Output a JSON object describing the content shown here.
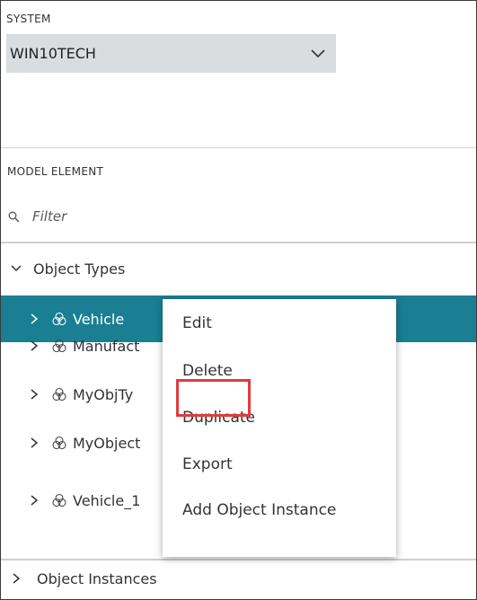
{
  "system": {
    "label": "SYSTEM",
    "selected_value": "WIN10TECH",
    "dropdown_icon": "chevron-down-icon"
  },
  "model_element": {
    "label": "MODEL ELEMENT",
    "filter_placeholder": "Filter",
    "filter_icon": "search-icon"
  },
  "tree": {
    "object_types": {
      "label": "Object Types",
      "expanded": true
    },
    "items": [
      {
        "label": "Vehicle",
        "selected": true,
        "icon": "cube-icon"
      },
      {
        "label": "Manufact",
        "selected": false,
        "icon": "cube-icon"
      },
      {
        "label": "MyObjTy",
        "selected": false,
        "icon": "cube-icon"
      },
      {
        "label": "MyObject",
        "selected": false,
        "icon": "cube-icon"
      },
      {
        "label": "Vehicle_1",
        "selected": false,
        "icon": "cube-icon"
      }
    ],
    "object_instances": {
      "label": "Object Instances",
      "expanded": false
    }
  },
  "context_menu": {
    "items": [
      "Edit",
      "Delete",
      "Duplicate",
      "Export",
      "Add Object Instance"
    ],
    "highlighted_item": "Delete",
    "highlight_color": "#e23b3b"
  },
  "colors": {
    "selected_row": "#1a7f93",
    "dropdown_bg": "#d9dde0"
  }
}
